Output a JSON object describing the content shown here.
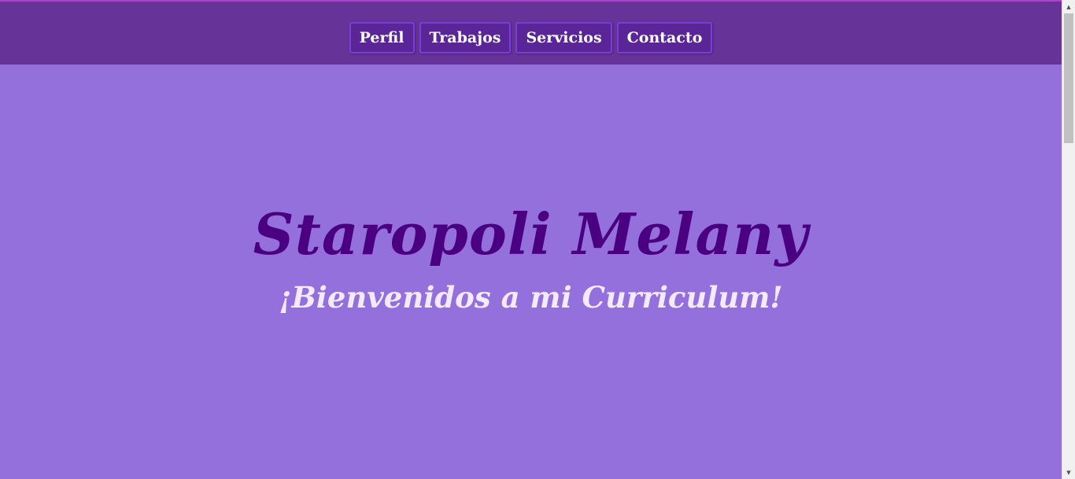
{
  "nav": {
    "items": [
      {
        "label": "Perfil"
      },
      {
        "label": "Trabajos"
      },
      {
        "label": "Servicios"
      },
      {
        "label": "Contacto"
      }
    ]
  },
  "hero": {
    "title": "Staropoli Melany",
    "subtitle": "¡Bienvenidos a mi Curriculum!"
  },
  "scrollbar": {
    "up_icon": "▲",
    "down_icon": "▼"
  },
  "colors": {
    "page_background": "#9370db",
    "navbar_background": "#663399",
    "nav_button_background": "#5a2597",
    "nav_button_border": "#7a3fd2",
    "title_color": "#4b0082",
    "subtitle_color": "#f3eaff"
  }
}
